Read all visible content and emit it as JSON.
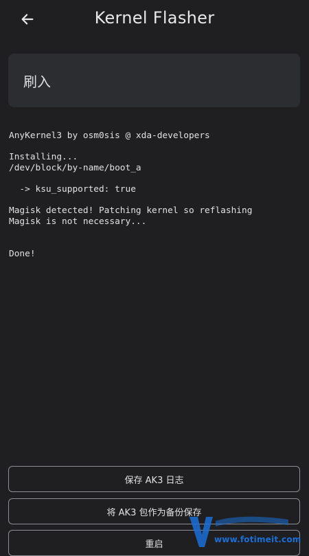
{
  "header": {
    "title": "Kernel Flasher",
    "back_icon": "arrow-left-icon"
  },
  "status": {
    "label": "刷入"
  },
  "log_lines": [
    "AnyKernel3 by osm0sis @ xda-developers",
    "",
    "Installing...",
    "/dev/block/by-name/boot_a",
    "",
    "  -> ksu_supported: true",
    "",
    "Magisk detected! Patching kernel so reflashing",
    "Magisk is not necessary...",
    "",
    "",
    "Done!"
  ],
  "actions": {
    "save_log": "保存 AK3 日志",
    "save_backup": "将 AK3 包作为备份保存",
    "reboot": "重启"
  },
  "watermark": {
    "text": "www.fotimeit.com",
    "color": "#1a6fd6"
  },
  "colors": {
    "background": "#1f1f22",
    "card": "#2c2d31",
    "button_border": "#8e8f95"
  }
}
